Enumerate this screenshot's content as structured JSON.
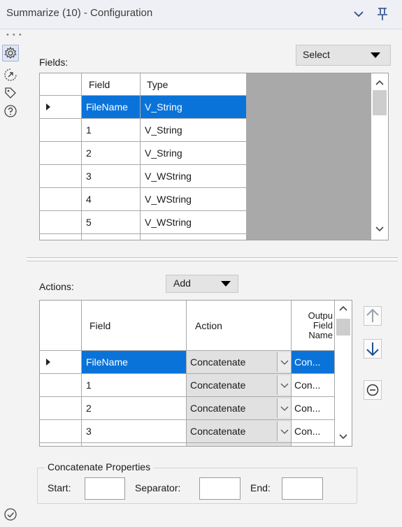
{
  "window": {
    "title": "Summarize (10) - Configuration",
    "chevron_icon": "chevron-down-icon",
    "pin_icon": "pin-icon"
  },
  "sidebar": {
    "icons": [
      "gear-icon",
      "dial-arrow-icon",
      "tag-icon",
      "help-icon",
      "check-circle-icon"
    ]
  },
  "fields_section": {
    "label": "Fields:",
    "select_label": "Select",
    "columns": [
      "Field",
      "Type"
    ],
    "rows": [
      {
        "field": "FileName",
        "type": "V_String",
        "selected": true
      },
      {
        "field": "1",
        "type": "V_String"
      },
      {
        "field": "2",
        "type": "V_String"
      },
      {
        "field": "3",
        "type": "V_WString"
      },
      {
        "field": "4",
        "type": "V_WString"
      },
      {
        "field": "5",
        "type": "V_WString"
      }
    ]
  },
  "actions_section": {
    "label": "Actions:",
    "add_label": "Add",
    "columns": [
      "Field",
      "Action",
      "Output Field Name"
    ],
    "output_header_lines": [
      "Outpu",
      "Field",
      "Name"
    ],
    "rows": [
      {
        "field": "FileName",
        "action": "Concatenate",
        "output": "Con...",
        "selected": true
      },
      {
        "field": "1",
        "action": "Concatenate",
        "output": "Con..."
      },
      {
        "field": "2",
        "action": "Concatenate",
        "output": "Con..."
      },
      {
        "field": "3",
        "action": "Concatenate",
        "output": "Con..."
      }
    ]
  },
  "concatenate_properties": {
    "title": "Concatenate Properties",
    "start_label": "Start:",
    "separator_label": "Separator:",
    "end_label": "End:",
    "start_value": "",
    "separator_value": "",
    "end_value": ""
  },
  "colors": {
    "selection": "#0a73d9",
    "accent_icon": "#2a4a8a",
    "grid_gray": "#a9a9a9"
  }
}
